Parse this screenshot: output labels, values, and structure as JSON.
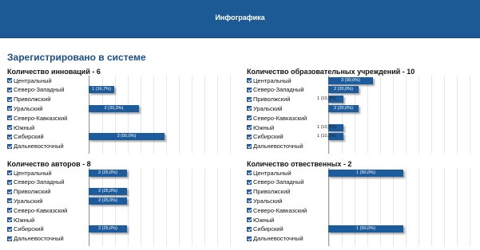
{
  "header": {
    "title": "Инфографика"
  },
  "section": {
    "title": "Зарегистрировано в системе"
  },
  "colors": {
    "header": "#1c5a96",
    "bar": "#1d5c9c",
    "title": "#1c4f8a"
  },
  "regions": [
    "Центральный",
    "Северо-Западный",
    "Приволжский",
    "Уральский",
    "Северо-Кавказский",
    "Южный",
    "Сибирский",
    "Дальневосточный"
  ],
  "charts": [
    {
      "title": "Количество инноваций - 6",
      "values": [
        0,
        1,
        0,
        2,
        0,
        0,
        3,
        0
      ],
      "labels": [
        "",
        "1 (16,7%)",
        "",
        "2 (33,3%)",
        "",
        "",
        "3 (50,0%)",
        ""
      ]
    },
    {
      "title": "Количество образовательных учреждений - 10",
      "values": [
        3,
        2,
        1,
        2,
        0,
        1,
        1,
        0
      ],
      "labels": [
        "3 (30,0%)",
        "2 (20,0%)",
        "1 (10,0%)",
        "2 (20,0%)",
        "",
        "1 (10,0%)",
        "1 (10,0%)",
        ""
      ]
    },
    {
      "title": "Количество авторов - 8",
      "values": [
        2,
        0,
        2,
        2,
        0,
        0,
        2,
        0
      ],
      "labels": [
        "2 (25,0%)",
        "",
        "2 (25,0%)",
        "2 (25,0%)",
        "",
        "",
        "2 (25,0%)",
        ""
      ]
    },
    {
      "title": "Количество отвественных - 2",
      "values": [
        1,
        0,
        0,
        0,
        0,
        0,
        1,
        0
      ],
      "labels": [
        "1 (50,0%)",
        "",
        "",
        "",
        "",
        "",
        "1 (50,0%)",
        ""
      ]
    }
  ],
  "chart_data": [
    {
      "type": "bar",
      "title": "Количество инноваций - 6",
      "categories": [
        "Центральный",
        "Северо-Западный",
        "Приволжский",
        "Уральский",
        "Северо-Кавказский",
        "Южный",
        "Сибирский",
        "Дальневосточный"
      ],
      "values": [
        0,
        1,
        0,
        2,
        0,
        0,
        3,
        0
      ]
    },
    {
      "type": "bar",
      "title": "Количество образовательных учреждений - 10",
      "categories": [
        "Центральный",
        "Северо-Западный",
        "Приволжский",
        "Уральский",
        "Северо-Кавказский",
        "Южный",
        "Сибирский",
        "Дальневосточный"
      ],
      "values": [
        3,
        2,
        1,
        2,
        0,
        1,
        1,
        0
      ]
    },
    {
      "type": "bar",
      "title": "Количество авторов - 8",
      "categories": [
        "Центральный",
        "Северо-Западный",
        "Приволжский",
        "Уральский",
        "Северо-Кавказский",
        "Южный",
        "Сибирский",
        "Дальневосточный"
      ],
      "values": [
        2,
        0,
        2,
        2,
        0,
        0,
        2,
        0
      ]
    },
    {
      "type": "bar",
      "title": "Количество отвественных - 2",
      "categories": [
        "Центральный",
        "Северо-Западный",
        "Приволжский",
        "Уральский",
        "Северо-Кавказский",
        "Южный",
        "Сибирский",
        "Дальневосточный"
      ],
      "values": [
        1,
        0,
        0,
        0,
        0,
        0,
        1,
        0
      ]
    }
  ]
}
